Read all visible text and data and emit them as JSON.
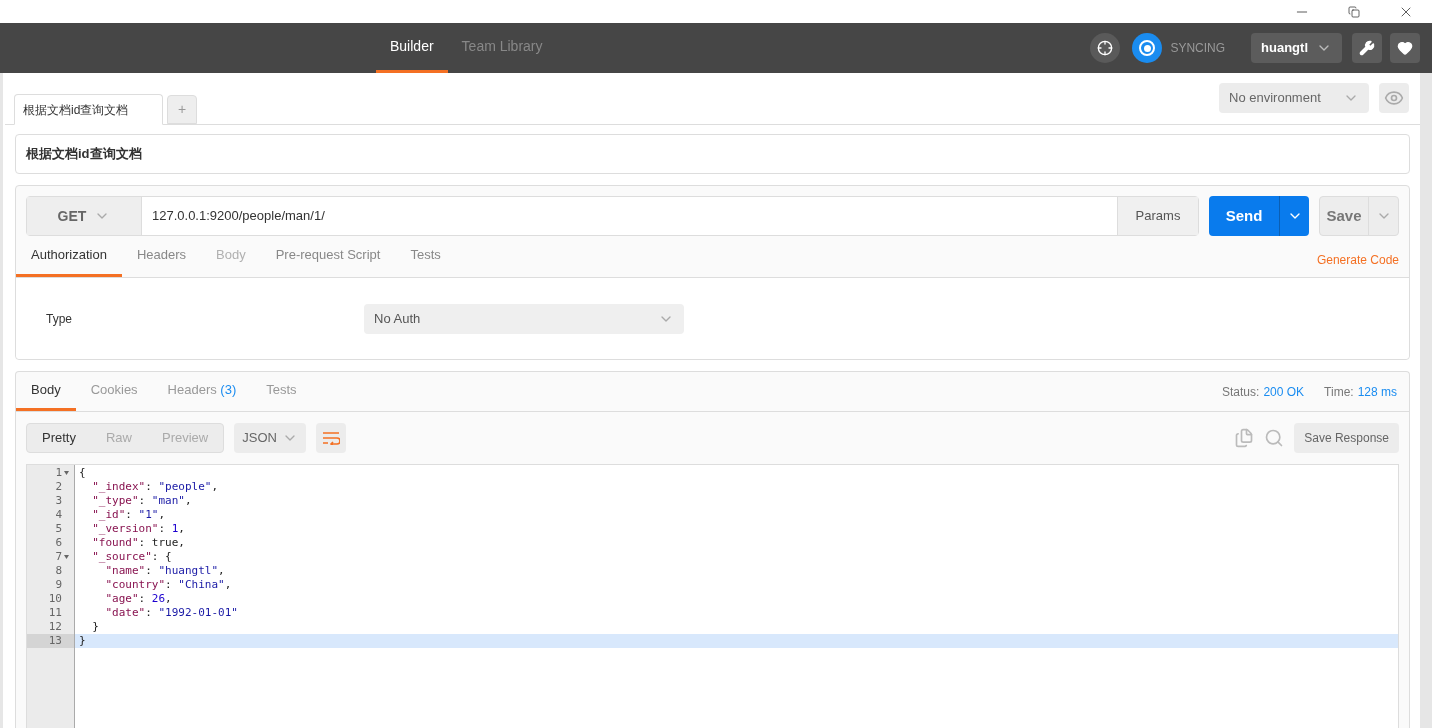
{
  "header": {
    "tabs": [
      {
        "label": "Builder",
        "selected": true
      },
      {
        "label": "Team Library",
        "selected": false
      }
    ],
    "sync_label": "SYNCING",
    "user": "huangtl"
  },
  "request_tabs": [
    {
      "label": "根据文档id查询文档",
      "selected": true
    }
  ],
  "new_tab": "+",
  "environment": "No environment",
  "request_name": "根据文档id查询文档",
  "method": "GET",
  "url": "127.0.0.1:9200/people/man/1/",
  "params": "Params",
  "send": "Send",
  "save": "Save",
  "request_sections": [
    {
      "label": "Authorization",
      "selected": true,
      "disabled": false
    },
    {
      "label": "Headers",
      "selected": false,
      "disabled": false
    },
    {
      "label": "Body",
      "selected": false,
      "disabled": true
    },
    {
      "label": "Pre-request Script",
      "selected": false,
      "disabled": false
    },
    {
      "label": "Tests",
      "selected": false,
      "disabled": false
    }
  ],
  "generate_code": "Generate Code",
  "auth": {
    "label": "Type",
    "value": "No Auth"
  },
  "response_tabs": [
    {
      "label": "Body",
      "selected": true
    },
    {
      "label": "Cookies",
      "selected": false
    },
    {
      "label": "Headers",
      "count": "(3)",
      "selected": false
    },
    {
      "label": "Tests",
      "selected": false
    }
  ],
  "status": {
    "label": "Status:",
    "value": "200 OK"
  },
  "time": {
    "label": "Time:",
    "value": "128 ms"
  },
  "view_modes": [
    {
      "label": "Pretty",
      "selected": true
    },
    {
      "label": "Raw",
      "selected": false
    },
    {
      "label": "Preview",
      "selected": false
    }
  ],
  "format": "JSON",
  "save_response": "Save Response",
  "code_lines": [
    {
      "number": "1",
      "foldable": true,
      "active": false,
      "tokens": [
        {
          "kind": "punct",
          "text": "{"
        }
      ]
    },
    {
      "number": "2",
      "foldable": false,
      "active": false,
      "tokens": [
        {
          "kind": "key",
          "text": "  \"_index\""
        },
        {
          "kind": "punct",
          "text": ": "
        },
        {
          "kind": "string",
          "text": "\"people\""
        },
        {
          "kind": "punct",
          "text": ","
        }
      ]
    },
    {
      "number": "3",
      "foldable": false,
      "active": false,
      "tokens": [
        {
          "kind": "key",
          "text": "  \"_type\""
        },
        {
          "kind": "punct",
          "text": ": "
        },
        {
          "kind": "string",
          "text": "\"man\""
        },
        {
          "kind": "punct",
          "text": ","
        }
      ]
    },
    {
      "number": "4",
      "foldable": false,
      "active": false,
      "tokens": [
        {
          "kind": "key",
          "text": "  \"_id\""
        },
        {
          "kind": "punct",
          "text": ": "
        },
        {
          "kind": "string",
          "text": "\"1\""
        },
        {
          "kind": "punct",
          "text": ","
        }
      ]
    },
    {
      "number": "5",
      "foldable": false,
      "active": false,
      "tokens": [
        {
          "kind": "key",
          "text": "  \"_version\""
        },
        {
          "kind": "punct",
          "text": ": "
        },
        {
          "kind": "number",
          "text": "1"
        },
        {
          "kind": "punct",
          "text": ","
        }
      ]
    },
    {
      "number": "6",
      "foldable": false,
      "active": false,
      "tokens": [
        {
          "kind": "key",
          "text": "  \"found\""
        },
        {
          "kind": "punct",
          "text": ": true,"
        }
      ]
    },
    {
      "number": "7",
      "foldable": true,
      "active": false,
      "tokens": [
        {
          "kind": "key",
          "text": "  \"_source\""
        },
        {
          "kind": "punct",
          "text": ": {"
        }
      ]
    },
    {
      "number": "8",
      "foldable": false,
      "active": false,
      "tokens": [
        {
          "kind": "key",
          "text": "    \"name\""
        },
        {
          "kind": "punct",
          "text": ": "
        },
        {
          "kind": "string",
          "text": "\"huangtl\""
        },
        {
          "kind": "punct",
          "text": ","
        }
      ]
    },
    {
      "number": "9",
      "foldable": false,
      "active": false,
      "tokens": [
        {
          "kind": "key",
          "text": "    \"country\""
        },
        {
          "kind": "punct",
          "text": ": "
        },
        {
          "kind": "string",
          "text": "\"China\""
        },
        {
          "kind": "punct",
          "text": ","
        }
      ]
    },
    {
      "number": "10",
      "foldable": false,
      "active": false,
      "tokens": [
        {
          "kind": "key",
          "text": "    \"age\""
        },
        {
          "kind": "punct",
          "text": ": "
        },
        {
          "kind": "number",
          "text": "26"
        },
        {
          "kind": "punct",
          "text": ","
        }
      ]
    },
    {
      "number": "11",
      "foldable": false,
      "active": false,
      "tokens": [
        {
          "kind": "key",
          "text": "    \"date\""
        },
        {
          "kind": "punct",
          "text": ": "
        },
        {
          "kind": "string",
          "text": "\"1992-01-01\""
        }
      ]
    },
    {
      "number": "12",
      "foldable": false,
      "active": false,
      "tokens": [
        {
          "kind": "punct",
          "text": "  }"
        }
      ]
    },
    {
      "number": "13",
      "foldable": false,
      "active": true,
      "tokens": [
        {
          "kind": "punct",
          "text": "}"
        }
      ]
    }
  ]
}
